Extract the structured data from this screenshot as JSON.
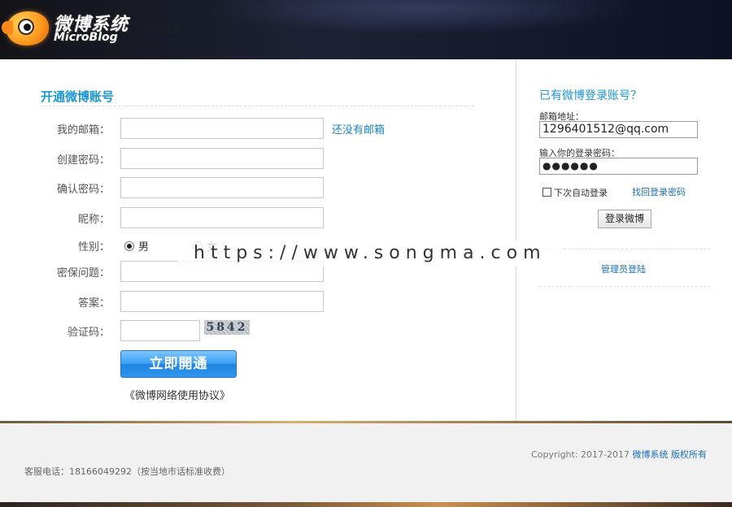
{
  "header": {
    "logo_cn": "微博系统",
    "logo_en": "MicroBlog",
    "page_subtitle": "用户注册"
  },
  "register": {
    "title": "开通微博账号",
    "email_label": "我的邮箱：",
    "email_hint": "还没有邮箱",
    "password_label": "创建密码：",
    "confirm_label": "确认密码：",
    "nickname_label": "昵称：",
    "gender_label": "性别：",
    "gender_male": "男",
    "gender_female": "女",
    "question_label": "密保问题：",
    "answer_label": "答案：",
    "captcha_label": "验证码：",
    "captcha_text": "5842",
    "submit_label": "立即開通",
    "agreement": "《微博网络使用协议》"
  },
  "login": {
    "title": "已有微博登录账号？",
    "email_label": "邮箱地址：",
    "email_value": "1296401512@qq.com",
    "password_label": "输入你的登录密码：",
    "password_value": "●●●●●●",
    "remember_label": "下次自动登录",
    "forgot_label": "找回登录密码",
    "login_button": "登录微博",
    "admin_link": "管理员登陆"
  },
  "footer": {
    "copyright_prefix": "Copyright: 2017-2017 ",
    "copyright_brand": "微博系统 版权所有",
    "service_phone": "客服电话：18166049292（按当地市话标准收费）"
  },
  "watermark": "https://www.songma.com",
  "colors": {
    "accent_blue": "#1a96d4",
    "link_blue": "#1a6fc0",
    "button_blue": "#2f96ee"
  }
}
